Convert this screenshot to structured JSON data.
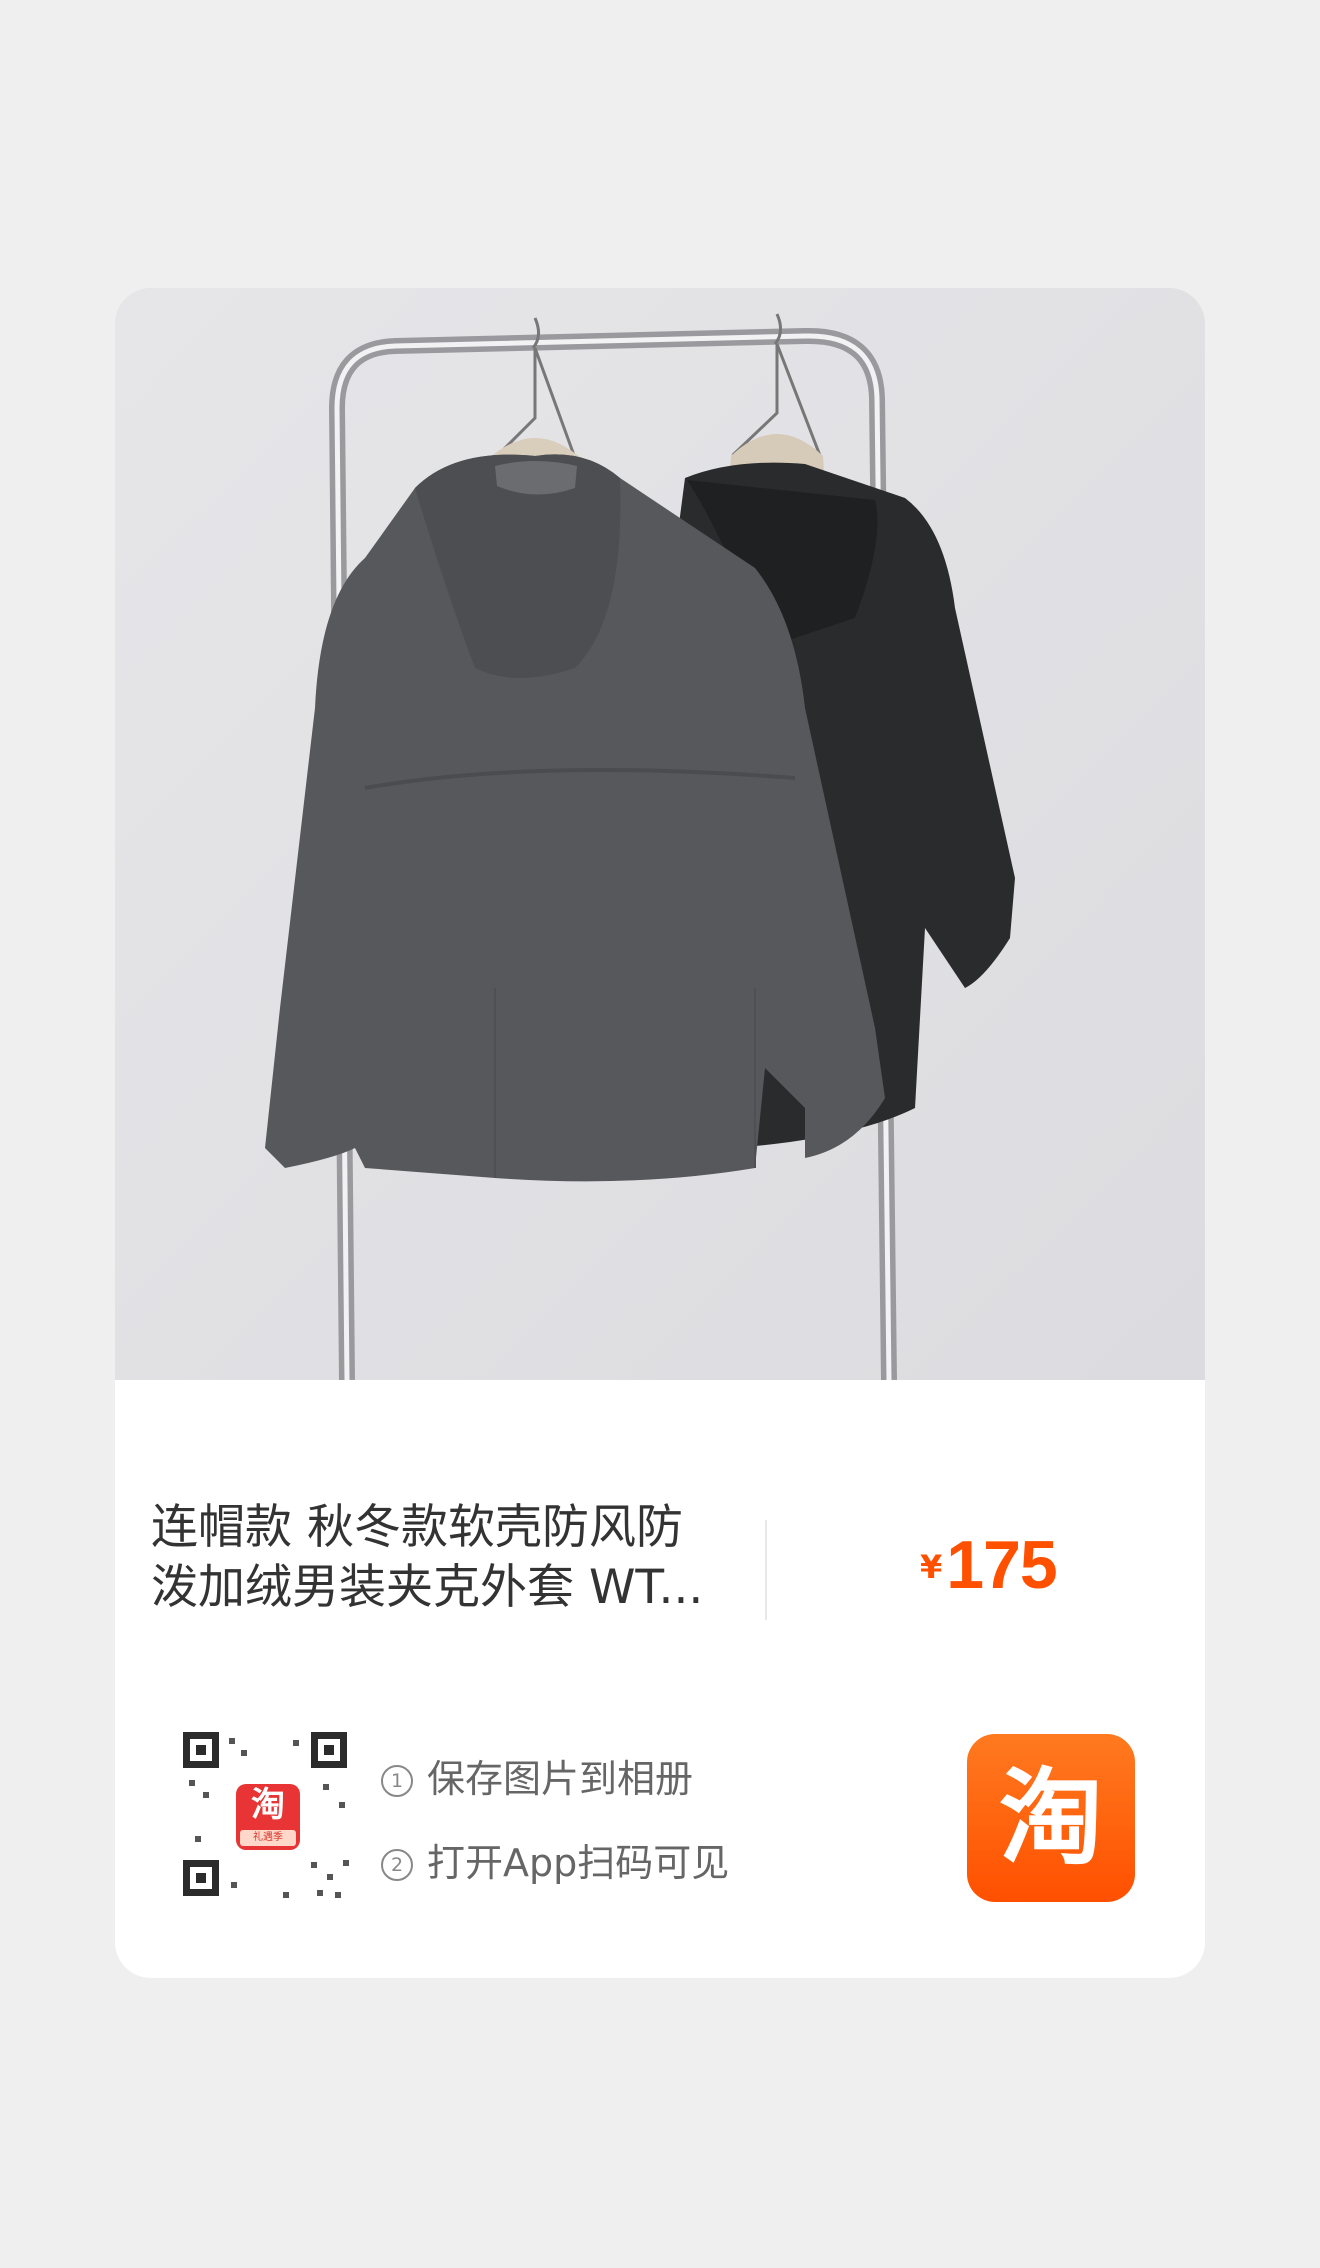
{
  "product": {
    "title_line1": "连帽款 秋冬款软壳防风防",
    "title_line2": "泼加绒男装夹克外套 WT...",
    "price_currency": "¥",
    "price_amount": "175",
    "image": "product-photo-two-hooded-jackets-on-rack"
  },
  "qr": {
    "logo_glyph": "淘",
    "logo_sub": "礼遇季"
  },
  "instructions": {
    "step1_num": "1",
    "step1_text": "保存图片到相册",
    "step2_num": "2",
    "step2_text": "打开App扫码可见"
  },
  "app_icon": {
    "glyph": "淘",
    "name": "taobao-app-icon"
  },
  "colors": {
    "price": "#ff5000",
    "app_icon": "#ff5000",
    "background": "#efefef",
    "card": "#ffffff"
  }
}
